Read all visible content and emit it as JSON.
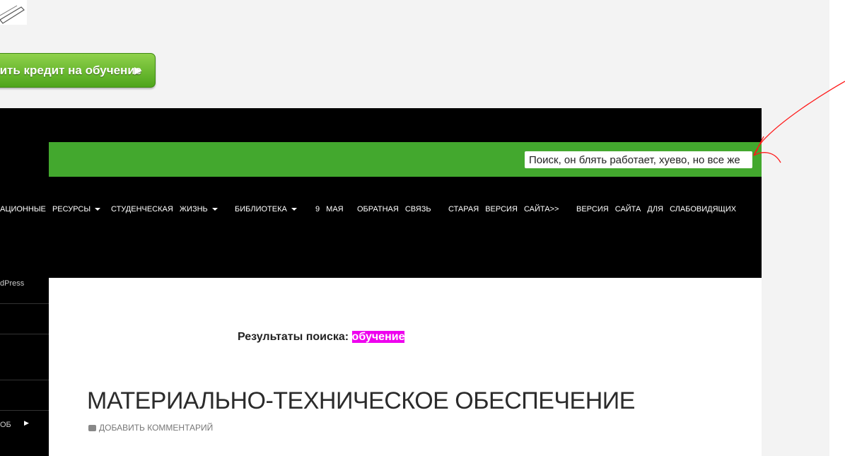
{
  "cta": {
    "label": "мить кредит на обучение",
    "arrow": "▶"
  },
  "search": {
    "value": "Поиск, он блять работает, хуево, но все же"
  },
  "nav": {
    "items": [
      {
        "label": "АЦИОННЫЕ РЕСУРСЫ",
        "dropdown": true
      },
      {
        "label": "СТУДЕНЧЕСКАЯ ЖИЗНЬ",
        "dropdown": true
      },
      {
        "label": "БИБЛИОТЕКА",
        "dropdown": true
      },
      {
        "label": "9 МАЯ",
        "dropdown": false
      },
      {
        "label": "ОБРАТНАЯ СВЯЗЬ",
        "dropdown": false
      },
      {
        "label": "СТАРАЯ ВЕРСИЯ САЙТА>>",
        "dropdown": false
      },
      {
        "label": "ВЕРСИЯ САЙТА ДЛЯ СЛАБОВИДЯЩИХ",
        "dropdown": false
      }
    ]
  },
  "sidebar": {
    "items": [
      {
        "label": "dPress"
      },
      {
        "label": ""
      },
      {
        "label": ""
      },
      {
        "label": ""
      },
      {
        "label": "ОБ"
      }
    ],
    "chevron": "▶"
  },
  "content": {
    "results_label": "Результаты поиска:",
    "query": "обучение",
    "post_title": "МАТЕРИАЛЬНО-ТЕХНИЧЕСКОЕ ОБЕСПЕЧЕНИЕ",
    "comment_link": "ДОБАВИТЬ КОММЕНТАРИЙ"
  },
  "colors": {
    "page_bg": "#f3f3f3",
    "header_bg": "#000000",
    "green_bar": "#43a82e",
    "highlight": "#ee00ee",
    "annotation": "#ff0000"
  }
}
